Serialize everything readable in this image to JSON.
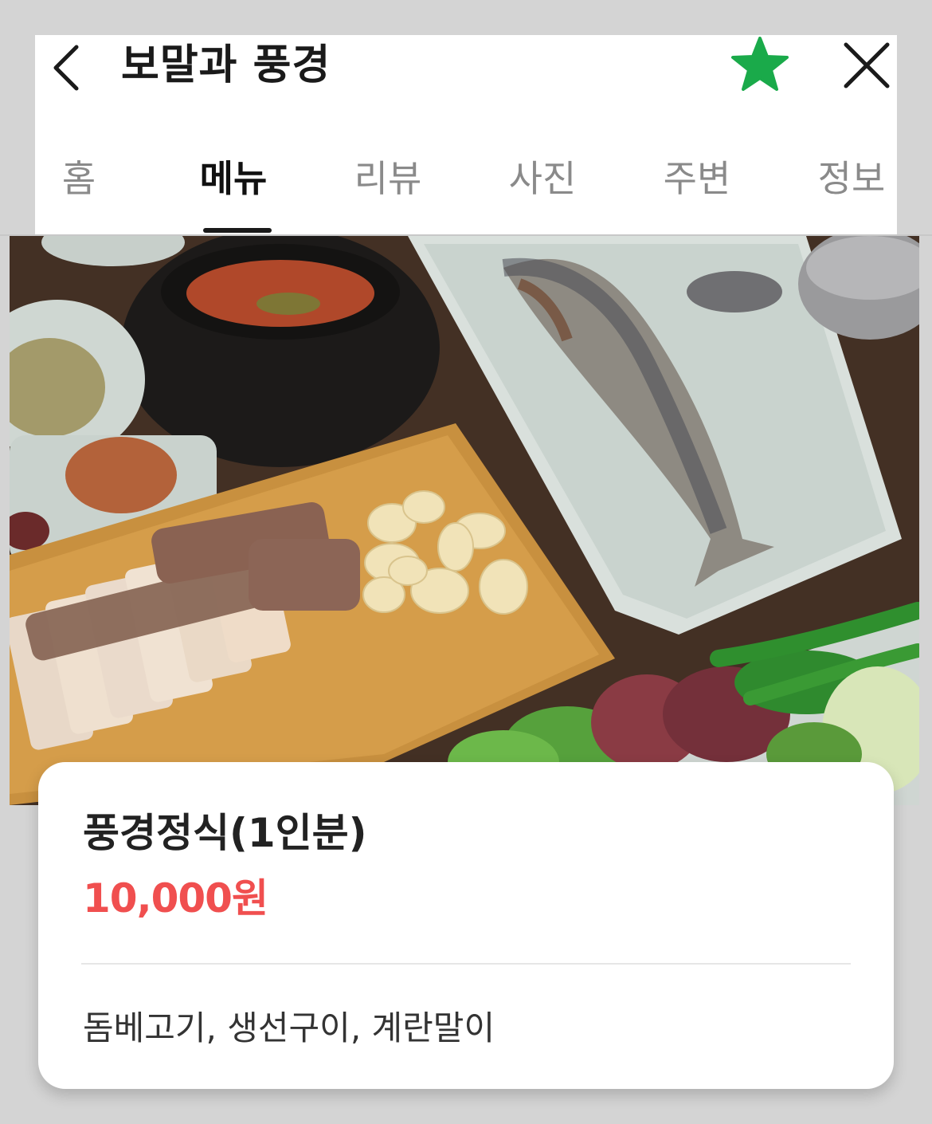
{
  "header": {
    "title": "보말과 풍경",
    "back_icon": "chevron-left-icon",
    "favorite_icon": "star-icon",
    "favorite_color": "#1aaa4a",
    "close_icon": "close-icon"
  },
  "tabs": [
    {
      "label": "홈",
      "active": false
    },
    {
      "label": "메뉴",
      "active": true
    },
    {
      "label": "리뷰",
      "active": false
    },
    {
      "label": "사진",
      "active": false
    },
    {
      "label": "주변",
      "active": false
    },
    {
      "label": "정보",
      "active": false
    }
  ],
  "menu_item": {
    "name": "풍경정식(1인분)",
    "price_value": "10,000",
    "price_unit": "원",
    "description": "돔베고기, 생선구이, 계란말이",
    "price_color": "#f04f4f"
  }
}
